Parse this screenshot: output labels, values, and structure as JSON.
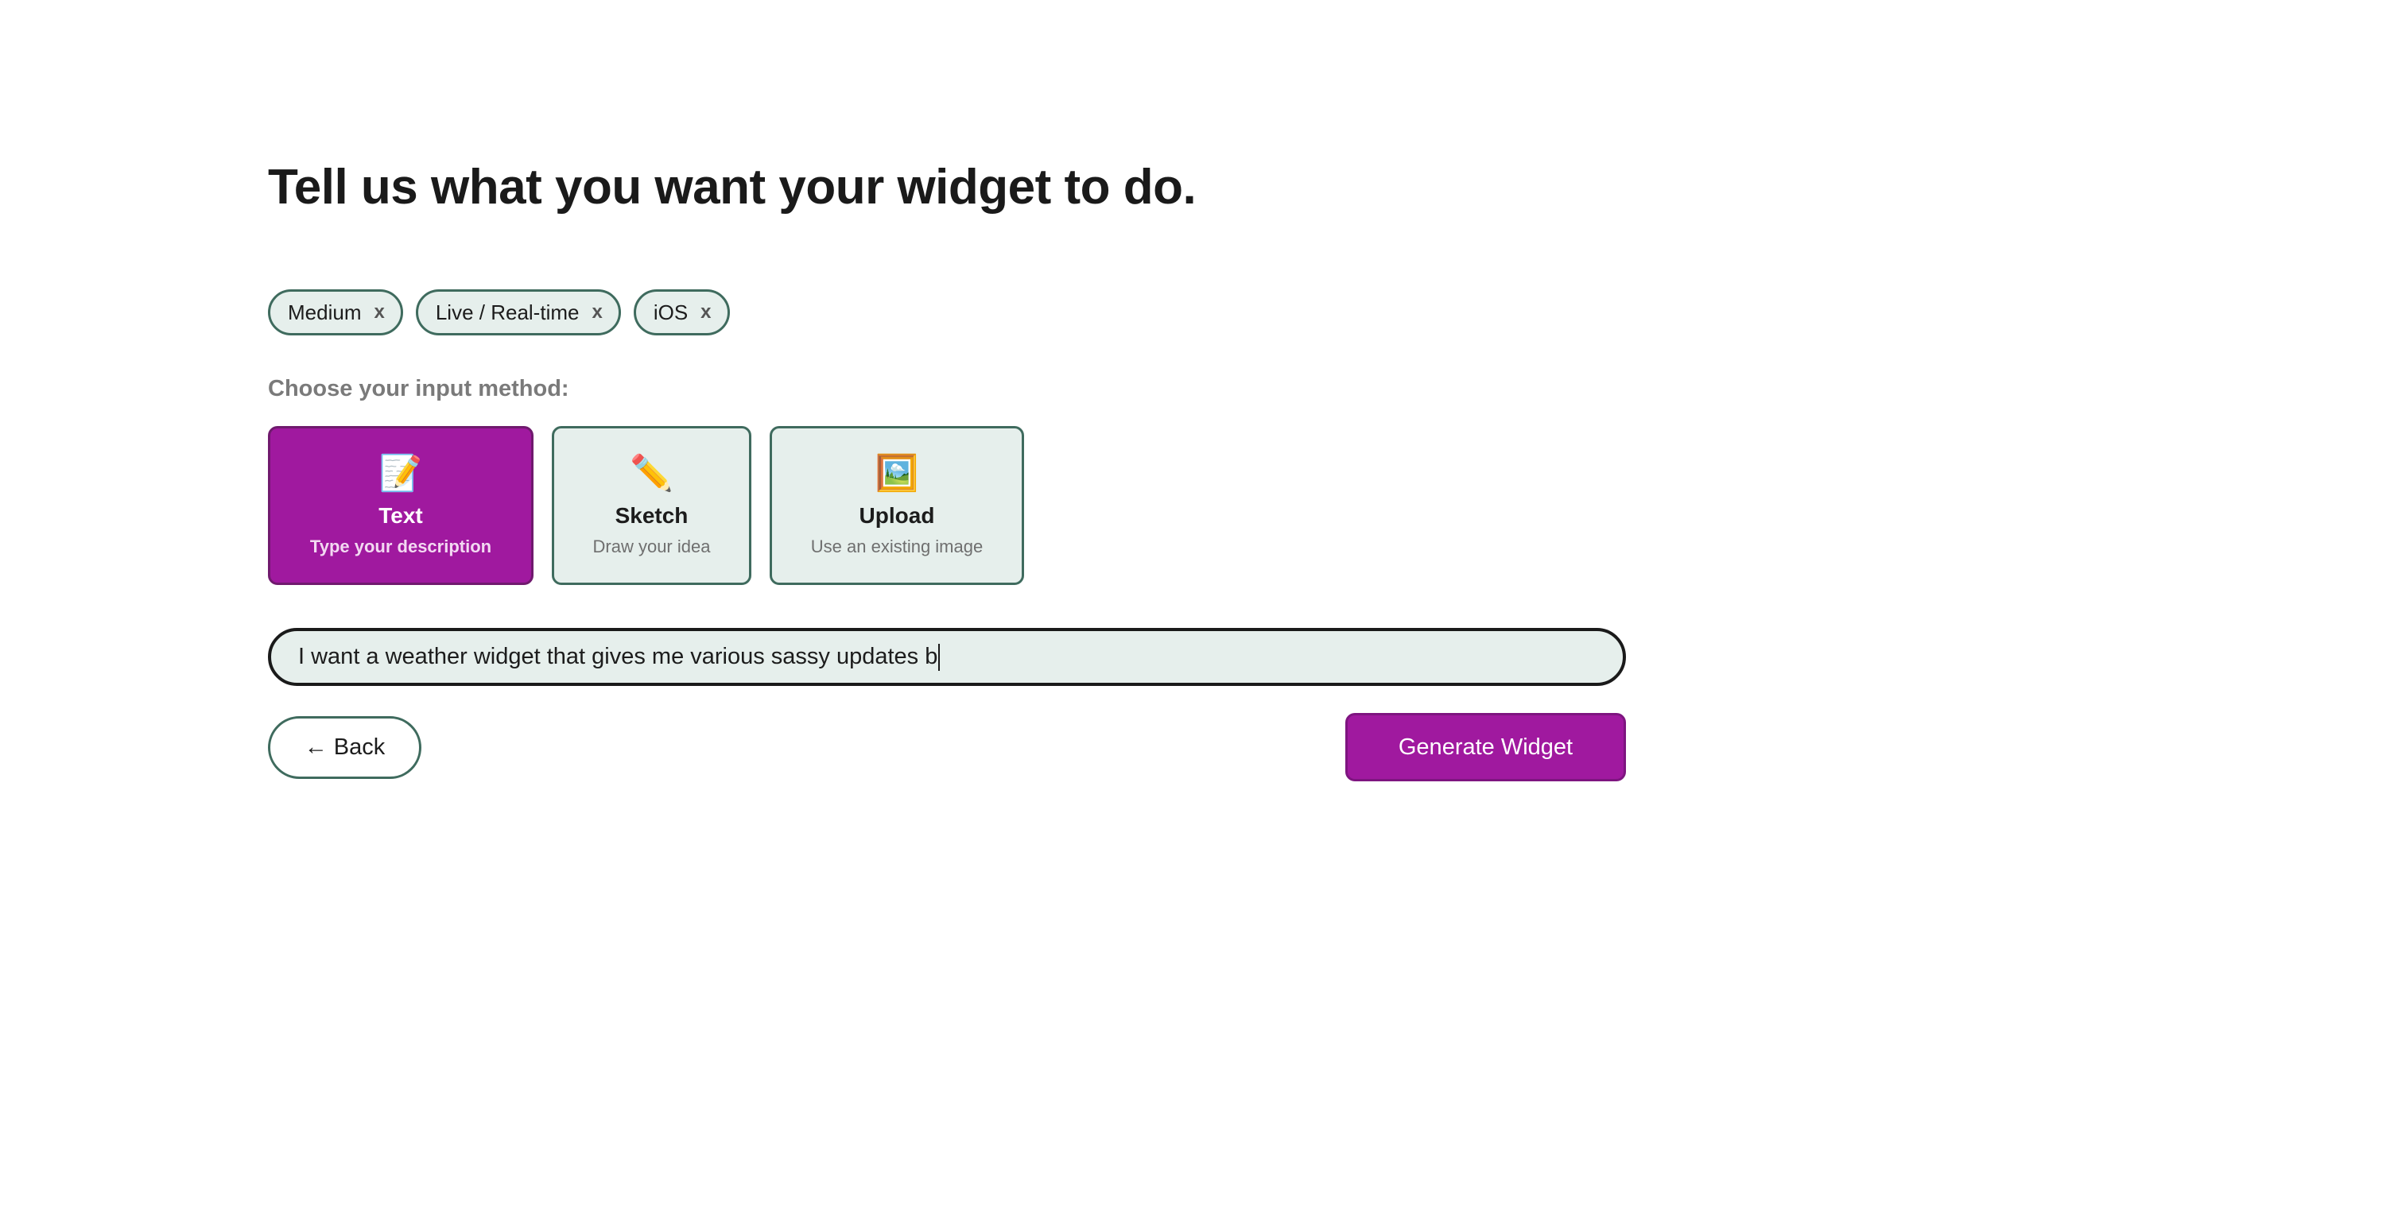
{
  "heading": "Tell us what you want your widget to do.",
  "chips": [
    {
      "label": "Medium",
      "remove": "x"
    },
    {
      "label": "Live / Real-time",
      "remove": "x"
    },
    {
      "label": "iOS",
      "remove": "x"
    }
  ],
  "input_method": {
    "label": "Choose your input method:",
    "selected": "Text",
    "options": [
      {
        "icon": "📝",
        "icon_name": "memo-icon",
        "name": "Text",
        "description": "Type your description"
      },
      {
        "icon": "✏️",
        "icon_name": "pencil-icon",
        "name": "Sketch",
        "description": "Draw your idea"
      },
      {
        "icon": "🖼️",
        "icon_name": "framed-picture-icon",
        "name": "Upload",
        "description": "Use an existing image"
      }
    ]
  },
  "prompt": {
    "value": "I want a weather widget that gives me various sassy updates b"
  },
  "actions": {
    "back_label": "← Back",
    "generate_label": "Generate Widget"
  },
  "colors": {
    "accent": "#a0199f",
    "chip_background": "#e6efec",
    "border_green": "#3f6b5e"
  }
}
